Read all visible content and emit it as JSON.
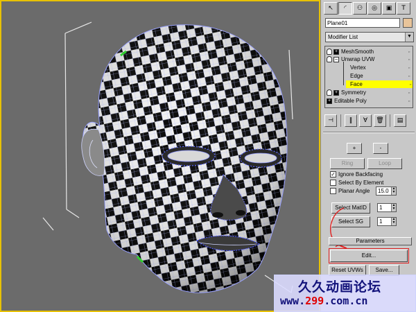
{
  "command_panel": {
    "tabs": [
      "create-tab",
      "modify-tab",
      "hierarchy-tab",
      "motion-tab",
      "display-tab",
      "utilities-tab"
    ],
    "tab_glyphs": [
      "↖",
      "◜",
      "⚇",
      "◎",
      "▣",
      "T"
    ],
    "object_name": "Plane01",
    "object_color": "#e8c49a",
    "modifier_list_label": "Modifier List",
    "stack": [
      {
        "label": "MeshSmooth",
        "type": "modifier"
      },
      {
        "label": "Unwrap UVW",
        "type": "modifier-expanded"
      },
      {
        "label": "Vertex",
        "type": "sub"
      },
      {
        "label": "Edge",
        "type": "sub"
      },
      {
        "label": "Face",
        "type": "sub-selected"
      },
      {
        "label": "Symmetry",
        "type": "modifier"
      },
      {
        "label": "Editable Poly",
        "type": "base"
      }
    ],
    "stack_toolbar": [
      "pin-stack-icon",
      "show-end-result-icon",
      "make-unique-icon",
      "remove-modifier-icon",
      "configure-sets-icon"
    ],
    "stack_toolbar_glyphs": [
      "⊣",
      "‖",
      "∀",
      "🗑",
      "▤"
    ],
    "selection": {
      "grow_label": "+",
      "shrink_label": "-",
      "ring_label": "Ring",
      "loop_label": "Loop",
      "ignore_backfacing_label": "Ignore Backfacing",
      "ignore_backfacing_checked": true,
      "select_by_element_label": "Select By Element",
      "select_by_element_checked": false,
      "planar_angle_label": "Planar Angle",
      "planar_angle_checked": false,
      "planar_angle_value": "15.0",
      "select_matid_label": "Select MatID",
      "select_matid_value": "1",
      "select_sg_label": "Select SG",
      "select_sg_value": "1"
    },
    "parameters": {
      "header": "Parameters",
      "edit_label": "Edit...",
      "reset_label": "Reset UVWs",
      "save_label": "Save..."
    }
  },
  "viewport": {
    "border_color": "#e8c200",
    "background": "#6b6b6b"
  },
  "watermark": {
    "title": "久久动画论坛",
    "url_prefix": "www.",
    "url_highlight": "299",
    "url_suffix": ".com.cn"
  }
}
